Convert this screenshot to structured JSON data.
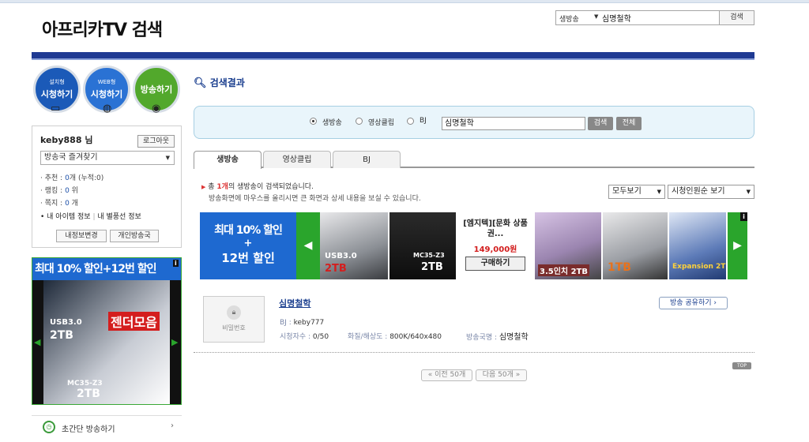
{
  "header": {
    "logo_text": "아프리카TV 검색",
    "search_category": "생방송",
    "search_value": "심명철학",
    "search_button": "검색"
  },
  "quick_buttons": [
    {
      "sub": "설치형",
      "label": "시청하기"
    },
    {
      "sub": "WEB형",
      "label": "시청하기"
    },
    {
      "sub": "",
      "label": "방송하기"
    }
  ],
  "user": {
    "name": "keby888 님",
    "logout": "로그아웃",
    "favorites": "방송국 즐겨찾기",
    "recommend_label": "· 추천 :",
    "recommend_value": "0",
    "recommend_unit": "개 (누적:0)",
    "ranking_label": "· 랭킹 :",
    "ranking_value": "0",
    "ranking_unit": "위",
    "note_label": "· 쪽지 :",
    "note_value": "0",
    "note_unit": "개",
    "item_info": "• 내 아이템 정보",
    "balloon_info": "내 별풍선 정보",
    "edit_info": "내정보변경",
    "my_station": "개인방송국"
  },
  "left_ad": {
    "headline": "최대 10% 할인+12번 할인",
    "cap1": "USB3.0",
    "cap2": "2TB",
    "cap3": "젠더모음",
    "cap4": "MC35-Z3",
    "cap5": "2TB"
  },
  "side_menu": {
    "label": "초간단 방송하기"
  },
  "results": {
    "title": "검색결과",
    "radio_live": "생방송",
    "radio_clip": "영상클립",
    "radio_bj": "BJ",
    "query": "심명철학",
    "search_btn": "검색",
    "all_btn": "전체",
    "tabs": [
      "생방송",
      "영상클립",
      "BJ"
    ],
    "summary_pre": "총",
    "summary_count": "1개",
    "summary_post": "의 생방송이 검색되었습니다.",
    "hint": "방송화면에 마우스를 올리시면 큰 화면과 상세 내용을 보실 수 있습니다.",
    "filter_view": "모두보기",
    "filter_sort": "시청인원순 보기"
  },
  "banner": {
    "promo1": "최대 10% 할인",
    "promo2": "+",
    "promo3": "12번 할인",
    "prod1_cap1": "USB3.0",
    "prod1_cap2": "2TB",
    "prod2_cap": "MC35-Z3",
    "prod2_cap2": "2TB",
    "mid_title": "[엠지텍][문화 상품권...",
    "mid_price": "149,000원",
    "mid_buy": "구매하기",
    "prod3_cap": "3.5인치 2TB",
    "prod4_cap": "1TB",
    "prod5_cap": "Expansion 2T"
  },
  "result_item": {
    "thumb_text": "비밀번호",
    "title": "심명철학",
    "share": "방송 공유하기 ›",
    "bj_label": "BJ :",
    "bj_value": "keby777",
    "viewers_label": "시청자수 :",
    "viewers_value": "0/50",
    "quality_label": "화질/해상도 :",
    "quality_value": "800K/640x480",
    "station_label": "방송국명 :",
    "station_value": "심명철학"
  },
  "pagination": {
    "prev": "« 이전 50개",
    "next": "다음 50개 »",
    "top": "TOP"
  }
}
